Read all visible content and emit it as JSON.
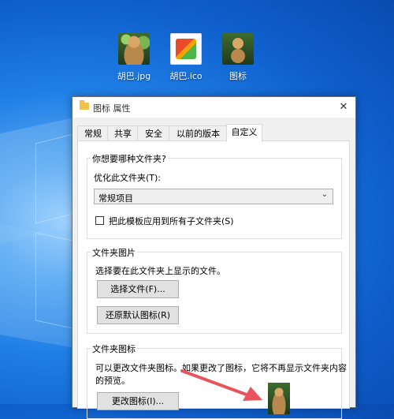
{
  "desktop": {
    "icons": [
      {
        "label": "胡巴.jpg",
        "icon": "photo-thumbnail-icon"
      },
      {
        "label": "胡巴.ico",
        "icon": "ico-thumbnail-icon"
      },
      {
        "label": "图标",
        "icon": "folder-thumbnail-icon"
      }
    ]
  },
  "dialog": {
    "title": "图标 属性",
    "close_glyph": "✕",
    "tabs": [
      {
        "label": "常规"
      },
      {
        "label": "共享"
      },
      {
        "label": "安全"
      },
      {
        "label": "以前的版本"
      },
      {
        "label": "自定义",
        "active": true
      }
    ],
    "folder_type": {
      "group_title": "你想要哪种文件夹?",
      "optimize_label": "优化此文件夹(T):",
      "selected_value": "常规项目",
      "checkbox_label": "把此模板应用到所有子文件夹(S)",
      "checkbox_checked": false
    },
    "folder_pictures": {
      "group_title": "文件夹图片",
      "description": "选择要在此文件夹上显示的文件。",
      "choose_file_button": "选择文件(F)...",
      "restore_default_button": "还原默认图标(R)"
    },
    "folder_icons": {
      "group_title": "文件夹图标",
      "description_line1": "可以更改文件夹图标。如果更改了图标，它将不再显示文件夹内容",
      "description_line2": "的预览。",
      "change_icon_button": "更改图标(I)..."
    }
  },
  "colors": {
    "annotation_arrow": "#e8545c",
    "desktop_blue": "#1f7fe6"
  }
}
